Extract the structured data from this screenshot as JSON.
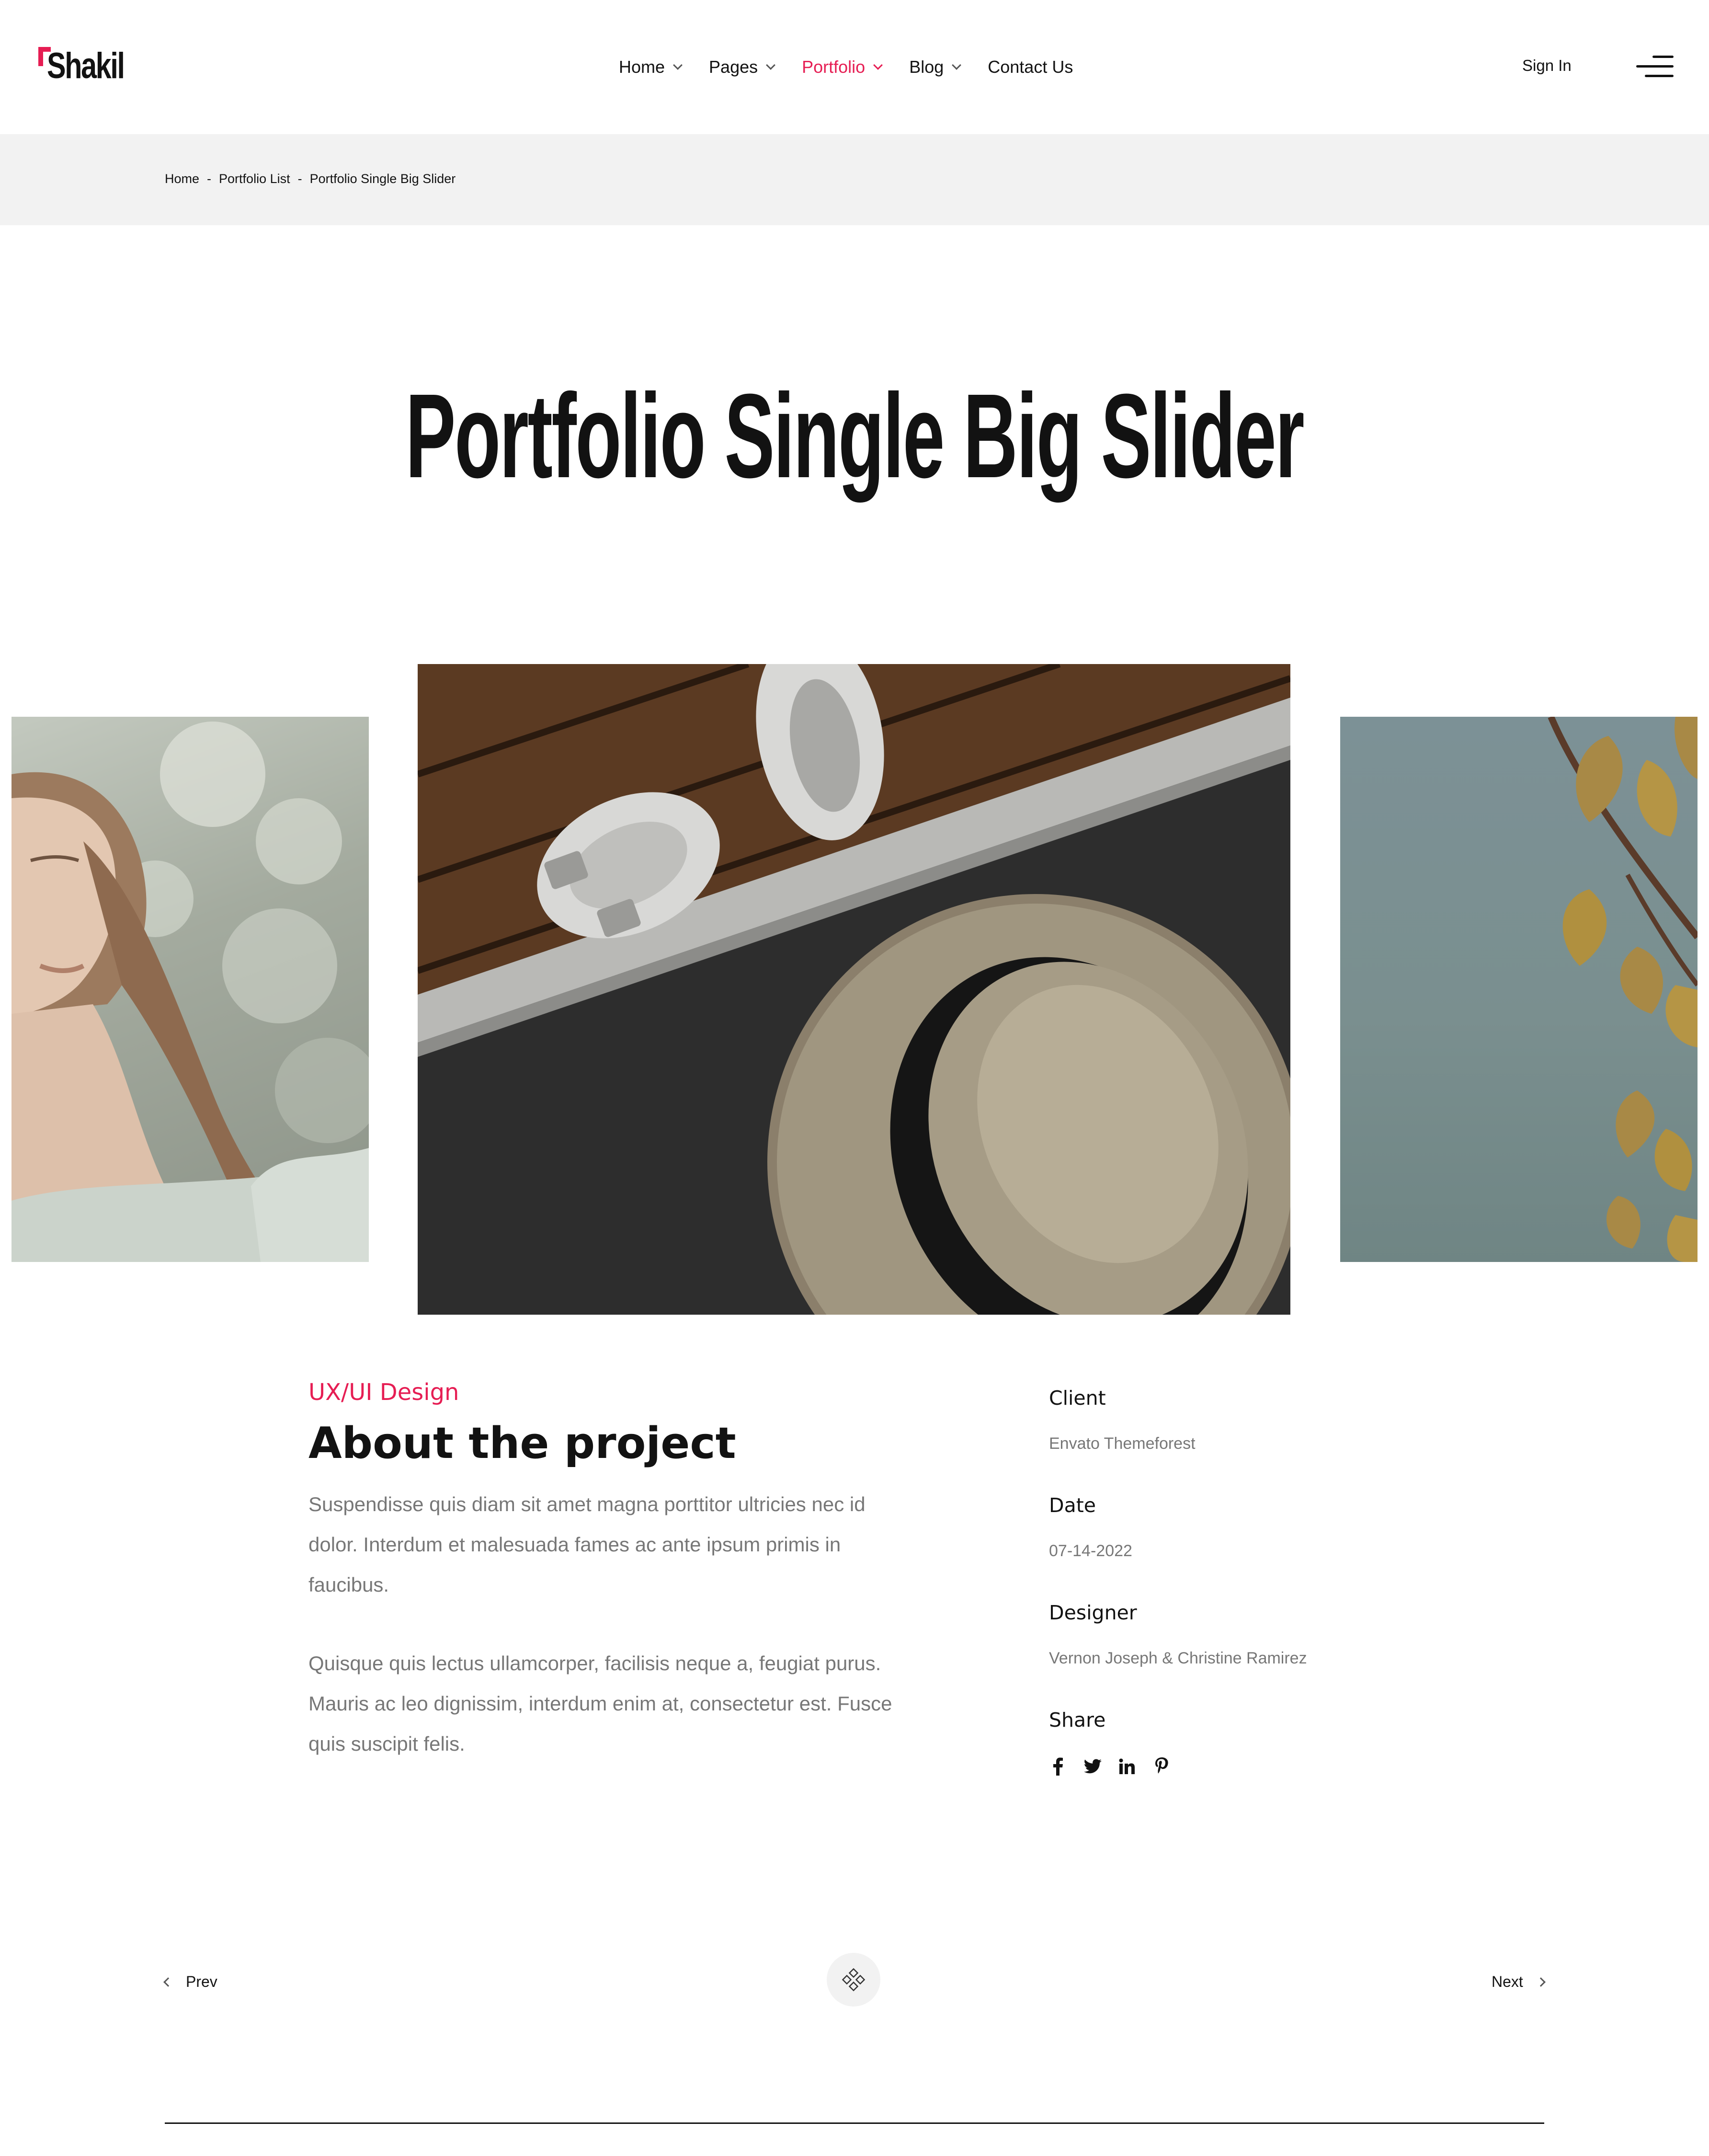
{
  "brand": {
    "name": "Shakil",
    "accent_color": "#e61d53"
  },
  "nav": {
    "items": [
      {
        "label": "Home",
        "has_dropdown": true,
        "active": false
      },
      {
        "label": "Pages",
        "has_dropdown": true,
        "active": false
      },
      {
        "label": "Portfolio",
        "has_dropdown": true,
        "active": true
      },
      {
        "label": "Blog",
        "has_dropdown": true,
        "active": false
      },
      {
        "label": "Contact Us",
        "has_dropdown": false,
        "active": false
      }
    ],
    "sign_in": "Sign In",
    "menu_icon": "hamburger-menu-icon"
  },
  "breadcrumb": {
    "items": [
      "Home",
      "Portfolio List",
      "Portfolio Single Big Slider"
    ],
    "separator": "-"
  },
  "page": {
    "title": "Portfolio Single Big Slider"
  },
  "slider": {
    "slides": [
      {
        "position": "left",
        "subject": "woman with closed eyes outdoors"
      },
      {
        "position": "center",
        "subject": "straw hat and white sandals on wooden deck"
      },
      {
        "position": "right",
        "subject": "ginkgo leaves against sky"
      }
    ]
  },
  "project": {
    "category": "UX/UI Design",
    "heading": "About the project",
    "paragraphs": [
      "Suspendisse quis diam sit amet magna porttitor ultricies nec id dolor. Interdum et malesuada fames ac ante ipsum primis in faucibus.",
      "Quisque quis lectus ullamcorper, facilisis neque a, feugiat purus. Mauris ac leo dignissim, interdum enim at, consectetur est. Fusce quis suscipit felis."
    ]
  },
  "meta": {
    "client_label": "Client",
    "client_value": "Envato Themeforest",
    "date_label": "Date",
    "date_value": "07-14-2022",
    "designer_label": "Designer",
    "designer_value": "Vernon Joseph & Christine Ramirez",
    "share_label": "Share",
    "share_icons": [
      "facebook-icon",
      "twitter-icon",
      "linkedin-icon",
      "pinterest-icon"
    ]
  },
  "pager": {
    "prev": "Prev",
    "next": "Next",
    "grid_icon": "grid-icon"
  }
}
